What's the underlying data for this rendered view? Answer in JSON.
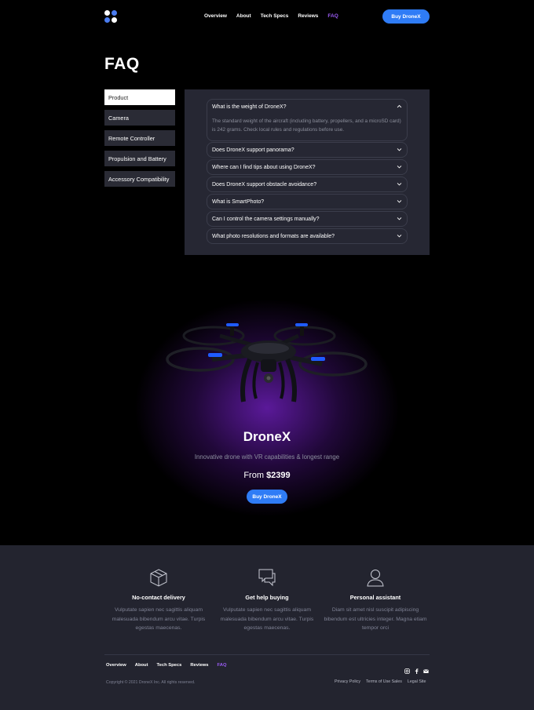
{
  "header": {
    "nav": [
      "Overview",
      "About",
      "Tech Specs",
      "Reviews",
      "FAQ"
    ],
    "active_nav": "FAQ",
    "cta_label": "Buy DroneX"
  },
  "faq": {
    "title": "FAQ",
    "categories": [
      "Product",
      "Camera",
      "Remote Controller",
      "Propulsion and Battery",
      "Accessory Compatibility"
    ],
    "active_category": "Product",
    "questions": [
      {
        "q": "What is the weight of DroneX?",
        "a": "The standard weight of the aircraft (including battery, propellers, and a microSD card) is 242 grams.  Check local rules and regulations before use.",
        "open": true
      },
      {
        "q": "Does DroneX support panorama?"
      },
      {
        "q": "Where can I find tips about using DroneX?"
      },
      {
        "q": "Does DroneX support obstacle avoidance?"
      },
      {
        "q": "What is SmartPhoto?"
      },
      {
        "q": "Can I control the camera settings manually?"
      },
      {
        "q": "What photo resolutions and formats are available?"
      }
    ]
  },
  "product": {
    "name": "DroneX",
    "tagline": "Innovative drone with VR capabilities & longest range",
    "price_prefix": "From",
    "price": "$2399",
    "cta_label": "Buy DroneX"
  },
  "features": [
    {
      "icon": "box-icon",
      "title": "No-contact delivery",
      "text": "Vulputate sapien nec sagittis aliquam malesuada bibendum arcu vitae. Turpis egestas maecenas."
    },
    {
      "icon": "chat-icon",
      "title": "Get help buying",
      "text": "Vulputate sapien nec sagittis aliquam malesuada bibendum arcu vitae. Turpis egestas maecenas."
    },
    {
      "icon": "user-icon",
      "title": "Personal assistant",
      "text": "Diam sit amet nisl suscipit adipiscing bibendum est ultricies integer. Magna etiam tempor orci"
    }
  ],
  "footer": {
    "nav": [
      "Overview",
      "About",
      "Tech Specs",
      "Reviews",
      "FAQ"
    ],
    "active_nav": "FAQ",
    "social": [
      "instagram-icon",
      "facebook-icon",
      "mail-icon"
    ],
    "copyright": "Copyright © 2021 DroneX Inc. All rights reserved.",
    "legal": [
      "Privacy Policy",
      "Terms of Use Sales",
      "Legal Site"
    ]
  },
  "colors": {
    "accent": "#2f7cf6",
    "active_link": "#9b5cf5",
    "panel": "#262733",
    "footer_bg": "#23242f"
  }
}
